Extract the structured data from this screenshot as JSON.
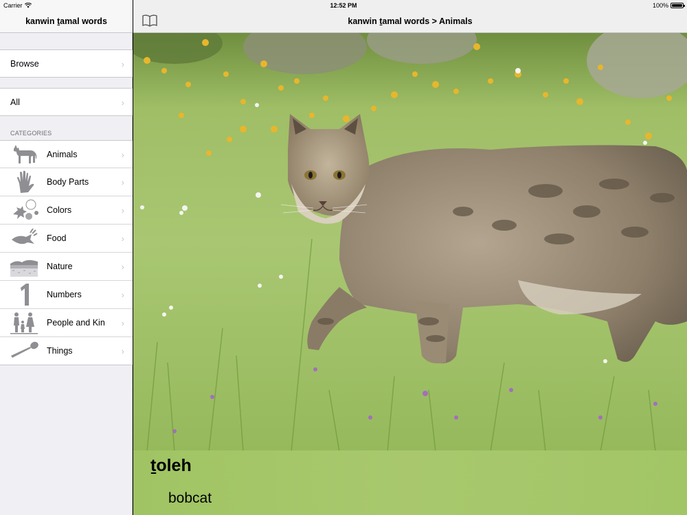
{
  "status_bar": {
    "carrier": "Carrier",
    "time": "12:52 PM",
    "battery_label": "100%",
    "battery_level": 1.0
  },
  "sidebar": {
    "title": "kanwin ṯamal words",
    "browse_label": "Browse",
    "all_label": "All",
    "section_header": "CATEGORIES",
    "categories": [
      {
        "label": "Animals",
        "icon": "wolf-icon"
      },
      {
        "label": "Body Parts",
        "icon": "hand-icon"
      },
      {
        "label": "Colors",
        "icon": "colors-icon"
      },
      {
        "label": "Food",
        "icon": "fish-icon"
      },
      {
        "label": "Nature",
        "icon": "landscape-icon"
      },
      {
        "label": "Numbers",
        "icon": "number-one-icon"
      },
      {
        "label": "People and Kin",
        "icon": "family-icon"
      },
      {
        "label": "Things",
        "icon": "club-icon"
      }
    ]
  },
  "main": {
    "title": "kanwin ṯamal words > Animals",
    "book_icon": "book-icon",
    "entry": {
      "word": "ṯoleh",
      "translation": "bobcat",
      "image": "bobcat-photo"
    }
  },
  "colors": {
    "sidebar_bg": "#efeff4",
    "caption_bg": "#a4c669",
    "chevron": "#c7c7cc"
  }
}
